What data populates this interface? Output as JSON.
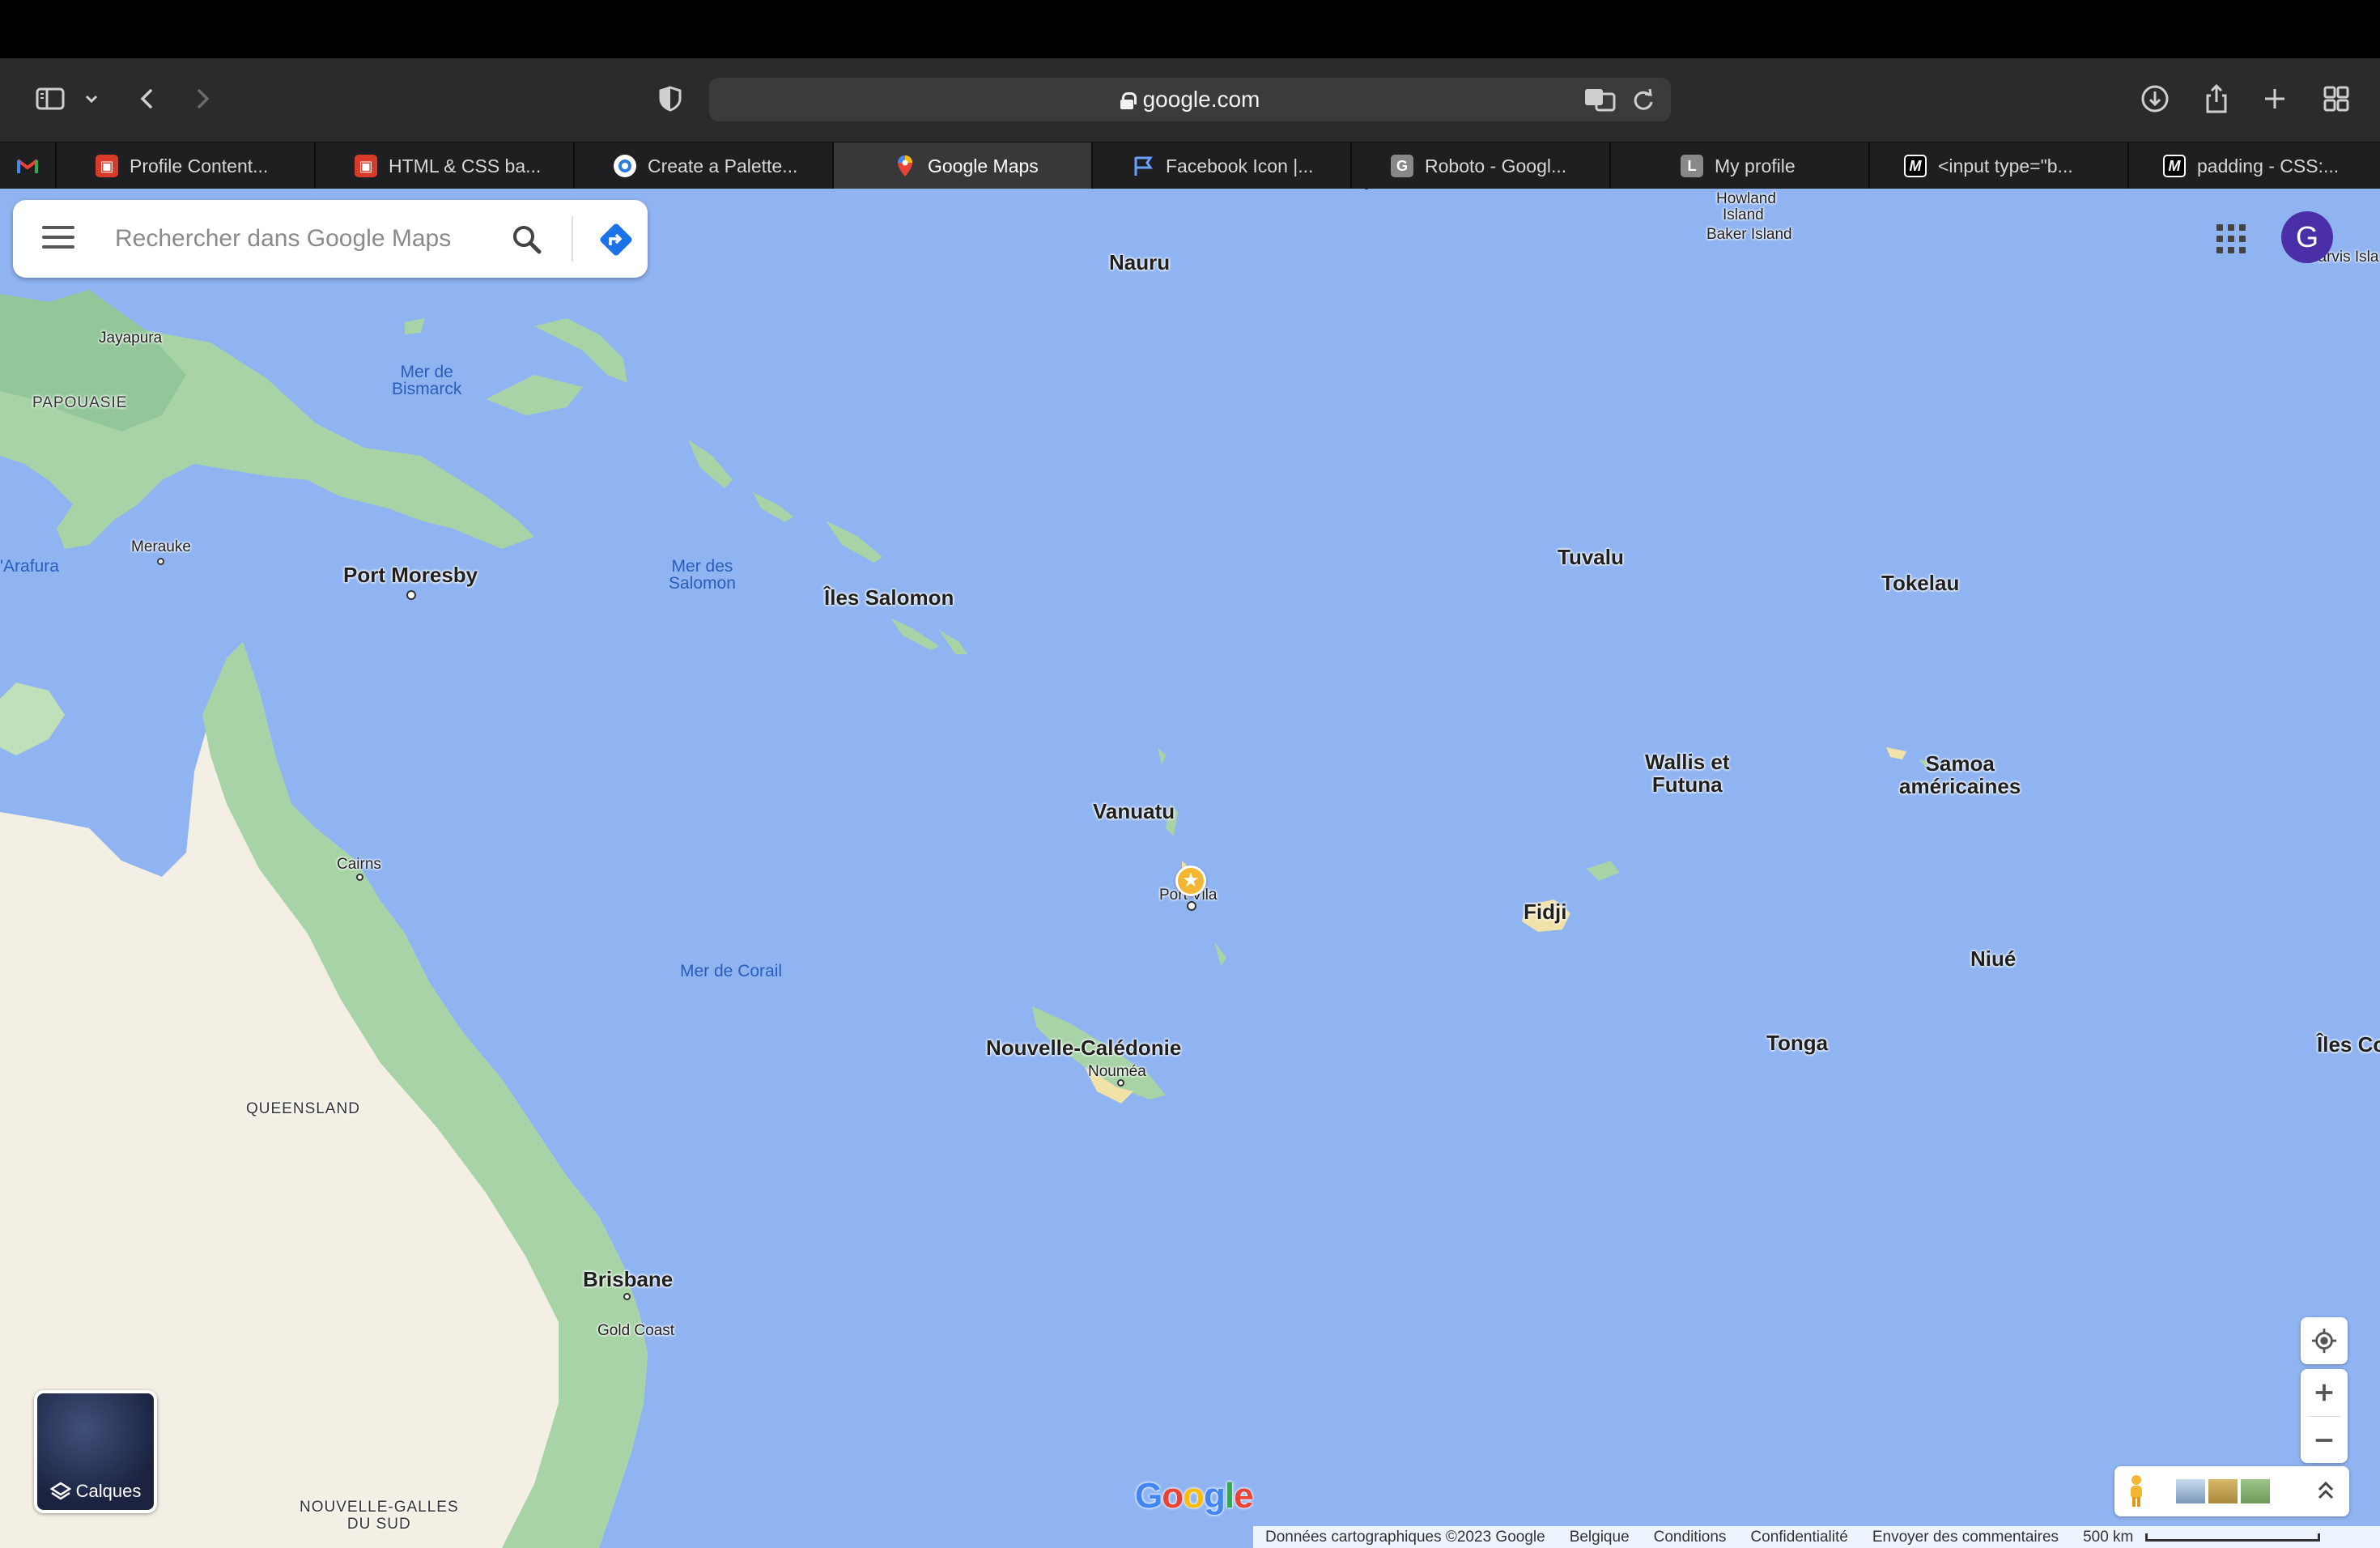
{
  "browser": {
    "url": "google.com",
    "tabs": [
      {
        "label": "",
        "icon": "gmail-icon"
      },
      {
        "label": "Profile Content...",
        "icon": "bus-icon"
      },
      {
        "label": "HTML & CSS ba...",
        "icon": "bus-icon"
      },
      {
        "label": "Create a Palette...",
        "icon": "palette-icon"
      },
      {
        "label": "Google Maps",
        "icon": "maps-pin-icon"
      },
      {
        "label": "Facebook Icon |...",
        "icon": "flag-icon"
      },
      {
        "label": "Roboto - Googl...",
        "icon": "google-fonts-icon"
      },
      {
        "label": "My profile",
        "icon": "letter-l-icon"
      },
      {
        "label": "<input type=\"b...",
        "icon": "mdn-icon"
      },
      {
        "label": "padding - CSS:...",
        "icon": "mdn-icon"
      }
    ]
  },
  "maps": {
    "search_placeholder": "Rechercher dans Google Maps",
    "avatar_letter": "G",
    "layers_label": "Calques",
    "google_logo": "Google",
    "footer": {
      "data": "Données cartographiques ©2023 Google",
      "country": "Belgique",
      "terms": "Conditions",
      "privacy": "Confidentialité",
      "feedback": "Envoyer des commentaires",
      "scale": "500 km"
    },
    "labels": {
      "nauru": "Nauru",
      "howland": "Howland",
      "island": "Island",
      "baker": "Baker Island",
      "jarvis": "Jarvis Isla",
      "jayapura": "Jayapura",
      "papouasie": "PAPOUASIE",
      "bismarck1": "Mer de",
      "bismarck2": "Bismarck",
      "merauke": "Merauke",
      "arafura": "'Arafura",
      "port_moresby": "Port Moresby",
      "salomon_sea1": "Mer des",
      "salomon_sea2": "Salomon",
      "iles_salomon": "Îles Salomon",
      "tuvalu": "Tuvalu",
      "tokelau": "Tokelau",
      "wallis1": "Wallis et",
      "wallis2": "Futuna",
      "samoa1": "Samoa",
      "samoa2": "américaines",
      "vanuatu": "Vanuatu",
      "port_vila": "Port Vila",
      "cairns": "Cairns",
      "fidji": "Fidji",
      "niue": "Niué",
      "mer_corail": "Mer de Corail",
      "nc": "Nouvelle-Calédonie",
      "noumea": "Nouméa",
      "tonga": "Tonga",
      "iles_cook": "Îles Co",
      "queensland": "QUEENSLAND",
      "brisbane": "Brisbane",
      "gold_coast": "Gold Coast",
      "nsw1": "NOUVELLE-GALLES",
      "nsw2": "DU SUD"
    }
  }
}
